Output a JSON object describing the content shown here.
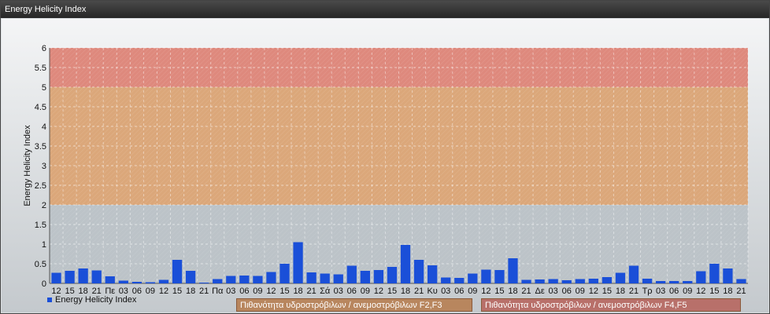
{
  "window": {
    "title": "Energy Helicity Index"
  },
  "chart_data": {
    "type": "bar",
    "title": "",
    "ylabel": "Energy Helicity Index",
    "xlabel": "",
    "ylim": [
      0,
      6
    ],
    "yticks": [
      0,
      0.5,
      1,
      1.5,
      2,
      2.5,
      3,
      3.5,
      4,
      4.5,
      5,
      5.5,
      6
    ],
    "grid": true,
    "categories": [
      "12",
      "15",
      "18",
      "21",
      "Πε",
      "03",
      "06",
      "09",
      "12",
      "15",
      "18",
      "21",
      "Πα",
      "03",
      "06",
      "09",
      "12",
      "15",
      "18",
      "21",
      "Σά",
      "03",
      "06",
      "09",
      "12",
      "15",
      "18",
      "21",
      "Κυ",
      "03",
      "06",
      "09",
      "12",
      "15",
      "18",
      "21",
      "Δε",
      "03",
      "06",
      "09",
      "12",
      "15",
      "18",
      "21",
      "Τρ",
      "03",
      "06",
      "09",
      "12",
      "15",
      "18",
      "21"
    ],
    "series": [
      {
        "name": "Energy Helicity Index",
        "color": "#1a4fd8",
        "values": [
          0.27,
          0.32,
          0.38,
          0.33,
          0.18,
          0.07,
          0.04,
          0.03,
          0.09,
          0.6,
          0.32,
          0.02,
          0.11,
          0.19,
          0.2,
          0.19,
          0.29,
          0.5,
          1.05,
          0.28,
          0.25,
          0.23,
          0.45,
          0.32,
          0.34,
          0.42,
          0.98,
          0.6,
          0.46,
          0.15,
          0.14,
          0.25,
          0.35,
          0.34,
          0.64,
          0.09,
          0.1,
          0.11,
          0.08,
          0.11,
          0.12,
          0.16,
          0.27,
          0.45,
          0.12,
          0.06,
          0.06,
          0.06,
          0.31,
          0.5,
          0.38,
          0.11
        ]
      }
    ],
    "bands": [
      {
        "label": "Πιθανότητα υδροστρόβιλων / ανεμοστρόβιλων F2,F3",
        "from": 2,
        "to": 5,
        "color": "#e0a26c"
      },
      {
        "label": "Πιθανότητα υδροστρόβιλων / ανεμοστρόβιλων F4,F5",
        "from": 5,
        "to": 6,
        "color": "#e47f70"
      }
    ],
    "legend_position": "bottom"
  }
}
